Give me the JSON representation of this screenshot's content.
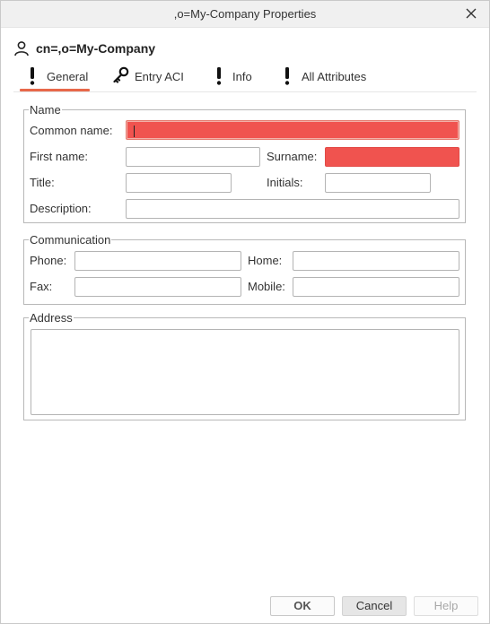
{
  "window": {
    "title": ",o=My-Company Properties"
  },
  "header": {
    "entry_name": "cn=,o=My-Company",
    "icon": "user-icon"
  },
  "tabs": [
    {
      "label": "General",
      "icon": "exclamation-icon",
      "active": true
    },
    {
      "label": "Entry ACI",
      "icon": "key-icon",
      "active": false
    },
    {
      "label": "Info",
      "icon": "exclamation-icon",
      "active": false
    },
    {
      "label": "All Attributes",
      "icon": "exclamation-icon",
      "active": false
    }
  ],
  "name_group": {
    "legend": "Name",
    "common_name_label": "Common name:",
    "common_name_value": "",
    "first_name_label": "First name:",
    "first_name_value": "",
    "surname_label": "Surname:",
    "surname_value": "",
    "title_label": "Title:",
    "title_value": "",
    "initials_label": "Initials:",
    "initials_value": "",
    "description_label": "Description:",
    "description_value": ""
  },
  "communication_group": {
    "legend": "Communication",
    "phone_label": "Phone:",
    "phone_value": "",
    "home_label": "Home:",
    "home_value": "",
    "fax_label": "Fax:",
    "fax_value": "",
    "mobile_label": "Mobile:",
    "mobile_value": ""
  },
  "address_group": {
    "legend": "Address",
    "address_value": ""
  },
  "buttons": {
    "ok": "OK",
    "cancel": "Cancel",
    "help": "Help"
  },
  "colors": {
    "required_field": "#f0534f",
    "accent": "#e8684a"
  }
}
